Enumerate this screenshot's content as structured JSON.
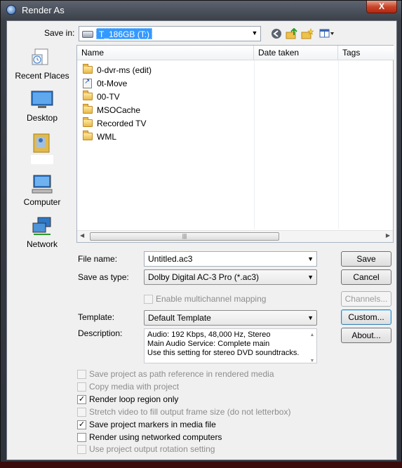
{
  "window": {
    "title": "Render As",
    "close_label": "X"
  },
  "toolbar": {
    "save_in_label": "Save in:",
    "save_in_value": "T_186GB (T:)"
  },
  "places": [
    {
      "name": "Recent Places",
      "icon": "recent-places-icon"
    },
    {
      "name": "Desktop",
      "icon": "desktop-icon"
    },
    {
      "name": "",
      "icon": "user-folder-icon"
    },
    {
      "name": "Computer",
      "icon": "computer-icon"
    },
    {
      "name": "Network",
      "icon": "network-icon"
    }
  ],
  "filelist": {
    "columns": [
      "Name",
      "Date taken",
      "Tags"
    ],
    "items": [
      {
        "name": "0-dvr-ms (edit)",
        "type": "folder"
      },
      {
        "name": "0t-Move",
        "type": "shortcut"
      },
      {
        "name": "00-TV",
        "type": "folder"
      },
      {
        "name": "MSOCache",
        "type": "folder"
      },
      {
        "name": "Recorded TV",
        "type": "folder"
      },
      {
        "name": "WML",
        "type": "folder"
      }
    ]
  },
  "form": {
    "file_name_label": "File name:",
    "file_name_value": "Untitled.ac3",
    "save_as_type_label": "Save as type:",
    "save_as_type_value": "Dolby Digital AC-3 Pro (*.ac3)",
    "multichannel_label": "Enable multichannel mapping",
    "template_label": "Template:",
    "template_value": "Default Template",
    "description_label": "Description:",
    "description_lines": [
      "Audio: 192 Kbps, 48,000 Hz, Stereo",
      "Main Audio Service: Complete main",
      "Use this setting for stereo DVD soundtracks."
    ]
  },
  "buttons": {
    "save": "Save",
    "cancel": "Cancel",
    "channels": "Channels...",
    "custom": "Custom...",
    "about": "About..."
  },
  "options": [
    {
      "label": "Save project as path reference in rendered media",
      "checked": false,
      "enabled": false
    },
    {
      "label": "Copy media with project",
      "checked": false,
      "enabled": false
    },
    {
      "label": "Render loop region only",
      "checked": true,
      "enabled": true
    },
    {
      "label": "Stretch video to fill output frame size (do not letterbox)",
      "checked": false,
      "enabled": false
    },
    {
      "label": "Save project markers in media file",
      "checked": true,
      "enabled": true
    },
    {
      "label": "Render using networked computers",
      "checked": false,
      "enabled": true
    },
    {
      "label": "Use project output rotation setting",
      "checked": false,
      "enabled": false
    }
  ]
}
